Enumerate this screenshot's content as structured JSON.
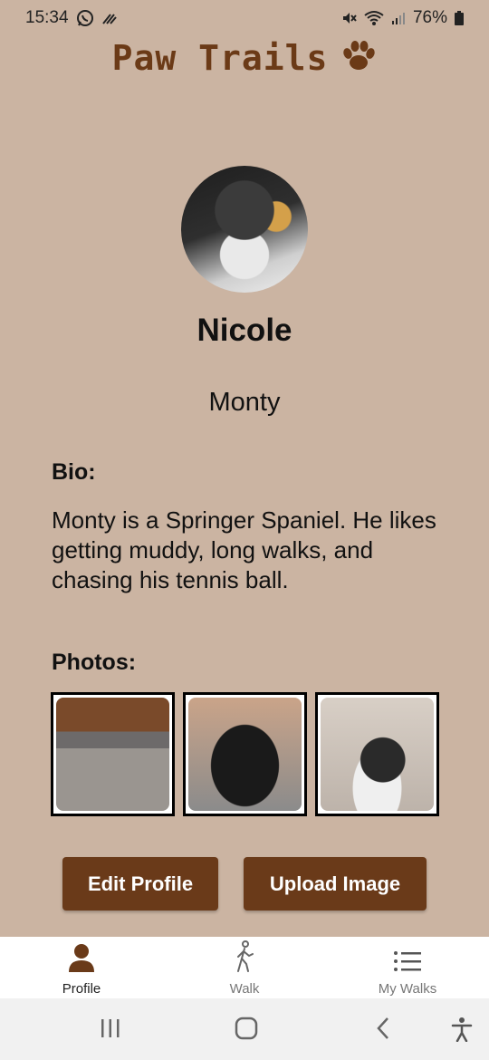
{
  "status_bar": {
    "time": "15:34",
    "battery": "76%",
    "icons_left": [
      "whatsapp-icon",
      "network-activity-icon"
    ],
    "icons_right": [
      "mute-icon",
      "wifi-icon",
      "signal-icon",
      "battery-icon"
    ]
  },
  "app": {
    "title": "Paw Trails",
    "title_color": "#6b3a17",
    "logo_icon": "paw-print-icon"
  },
  "profile": {
    "owner_name": "Nicole",
    "dog_name": "Monty",
    "bio_label": "Bio:",
    "bio_text": "Monty is a Springer Spaniel. He likes getting muddy, long walks, and chasing his tennis ball.",
    "photos_label": "Photos:",
    "photos": [
      "dog-photo",
      "dog-photo",
      "dog-photo"
    ]
  },
  "actions": {
    "edit_profile": "Edit Profile",
    "upload_image": "Upload Image",
    "button_color": "#6a3a19"
  },
  "bottom_nav": {
    "items": [
      {
        "label": "Profile",
        "icon": "person-icon",
        "active": true
      },
      {
        "label": "Walk",
        "icon": "walking-icon",
        "active": false
      },
      {
        "label": "My Walks",
        "icon": "list-icon",
        "active": false
      }
    ]
  },
  "system_nav": [
    "recent-apps-icon",
    "home-icon",
    "back-icon",
    "accessibility-icon"
  ],
  "colors": {
    "background": "#cbb4a2",
    "accent": "#6a3a19"
  }
}
